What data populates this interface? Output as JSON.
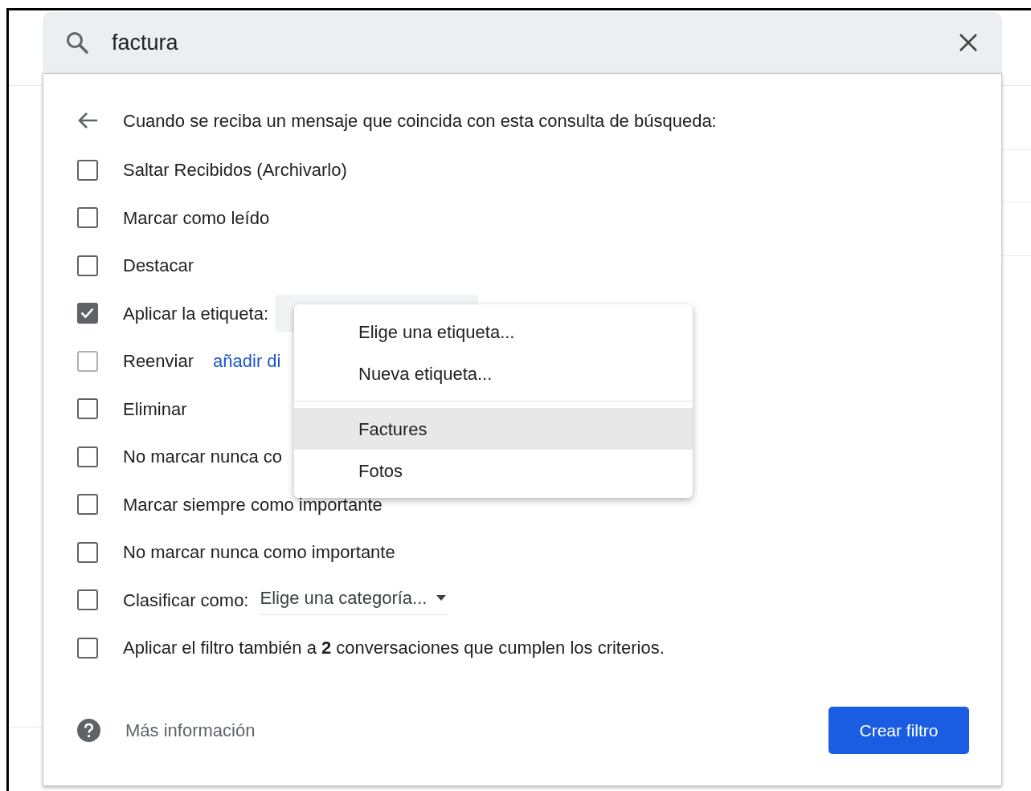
{
  "search": {
    "query": "factura"
  },
  "intro": "Cuando se reciba un mensaje que coincida con esta consulta de búsqueda:",
  "options": [
    {
      "kind": "checkbox",
      "label": "Saltar Recibidos (Archivarlo)",
      "checked": false,
      "disabled": false
    },
    {
      "kind": "checkbox",
      "label": "Marcar como leído",
      "checked": false,
      "disabled": false
    },
    {
      "kind": "checkbox",
      "label": "Destacar",
      "checked": false,
      "disabled": false
    },
    {
      "kind": "label-select",
      "label": "Aplicar la etiqueta:",
      "checked": true,
      "disabled": false
    },
    {
      "kind": "link",
      "label": "Reenviar",
      "link": "añadir di",
      "checked": false,
      "disabled": true
    },
    {
      "kind": "checkbox",
      "label": "Eliminar",
      "checked": false,
      "disabled": false
    },
    {
      "kind": "checkbox",
      "label": "No marcar nunca co",
      "checked": false,
      "disabled": false
    },
    {
      "kind": "checkbox",
      "label": "Marcar siempre como importante",
      "checked": false,
      "disabled": false
    },
    {
      "kind": "checkbox",
      "label": "No marcar nunca como importante",
      "checked": false,
      "disabled": false
    },
    {
      "kind": "category-select",
      "label": "Clasificar como:",
      "value": "Elige una categoría...",
      "checked": false,
      "disabled": false
    },
    {
      "kind": "checkbox",
      "label": "Aplicar el filtro también a **2** conversaciones que cumplen los criterios.",
      "checked": false,
      "disabled": false
    }
  ],
  "label_menu": {
    "groups": [
      {
        "items": [
          {
            "label": "Elige una etiqueta...",
            "selected": false
          },
          {
            "label": "Nueva etiqueta...",
            "selected": false
          }
        ]
      },
      {
        "items": [
          {
            "label": "Factures",
            "selected": true
          },
          {
            "label": "Fotos",
            "selected": false
          }
        ]
      }
    ]
  },
  "help_link": "Más información",
  "create_button": "Crear filtro"
}
